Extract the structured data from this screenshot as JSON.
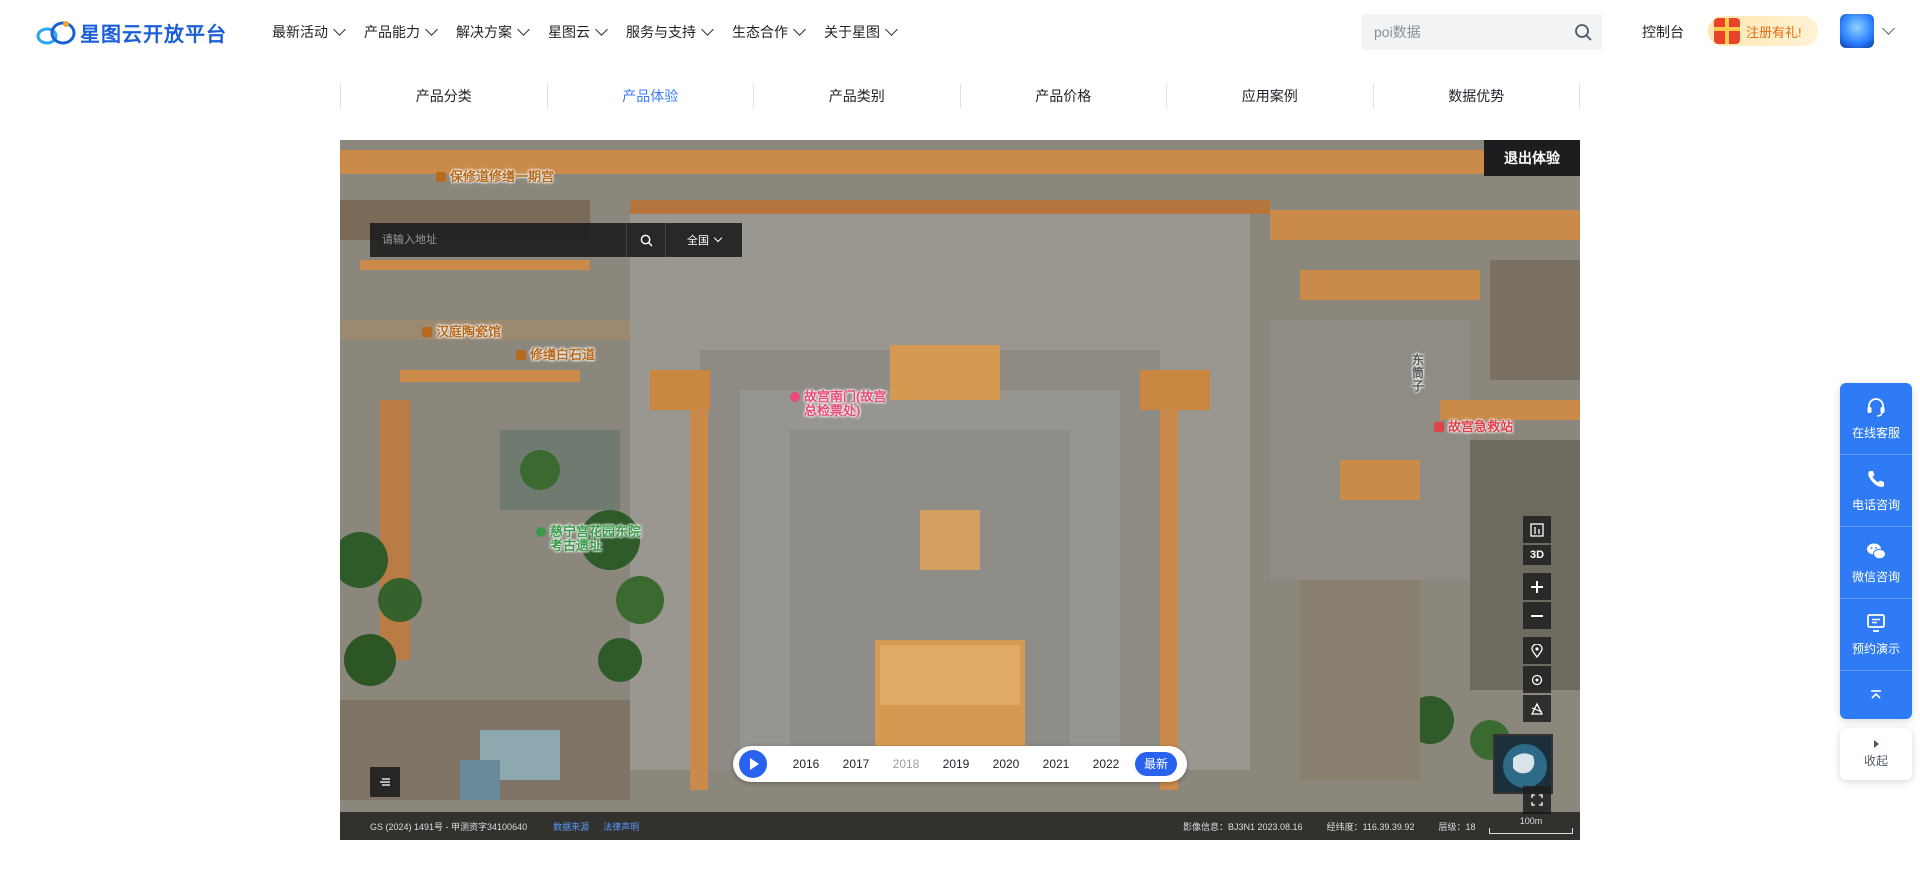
{
  "header": {
    "logo_text": "星图云开放平台",
    "nav": [
      {
        "label": "最新活动"
      },
      {
        "label": "产品能力"
      },
      {
        "label": "解决方案"
      },
      {
        "label": "星图云"
      },
      {
        "label": "服务与支持"
      },
      {
        "label": "生态合作"
      },
      {
        "label": "关于星图"
      }
    ],
    "search_placeholder": "poi数据",
    "console_label": "控制台",
    "promo_label": "注册有礼!"
  },
  "tabs": [
    {
      "label": "产品分类"
    },
    {
      "label": "产品体验",
      "active": true
    },
    {
      "label": "产品类别"
    },
    {
      "label": "产品价格"
    },
    {
      "label": "应用案例"
    },
    {
      "label": "数据优势"
    }
  ],
  "map": {
    "exit_label": "退出体验",
    "address_placeholder": "请输入地址",
    "region_label": "全国",
    "pois": {
      "p1": "保修道修缮一期宫",
      "p2": "汉庭陶瓷馆",
      "p3": "修缮白石道",
      "p4_line1": "故宫南门(故宫",
      "p4_line2": "总检票处)",
      "p5_line1": "慈宁宫花园东院",
      "p5_line2": "考古遗址",
      "p6": "故宫急救站",
      "p7": "东筒子"
    },
    "controls": {
      "three_d_label": "3D"
    },
    "timeline": {
      "years": [
        "2016",
        "2017",
        "2018",
        "2019",
        "2020",
        "2021",
        "2022"
      ],
      "disabled_year": "2018",
      "latest_label": "最新"
    },
    "footer": {
      "license": "GS (2024) 1491号 - 甲测资字34100640",
      "data_source": "数据来源",
      "legal": "法律声明",
      "image_info": "影像信息：BJ3N1 2023.08.16",
      "coords": "经纬度：116.39.39.92",
      "level": "层级：18",
      "scale": "100m"
    }
  },
  "float_panel": {
    "items": [
      {
        "label": "在线客服"
      },
      {
        "label": "电话咨询"
      },
      {
        "label": "微信咨询"
      },
      {
        "label": "预约演示"
      }
    ],
    "collapse_label": "收起"
  },
  "colors": {
    "brand": "#1b5fd8",
    "accent": "#2f7bf5",
    "tab_active": "#3b7cf6",
    "timeline_active": "#2a62f0"
  }
}
